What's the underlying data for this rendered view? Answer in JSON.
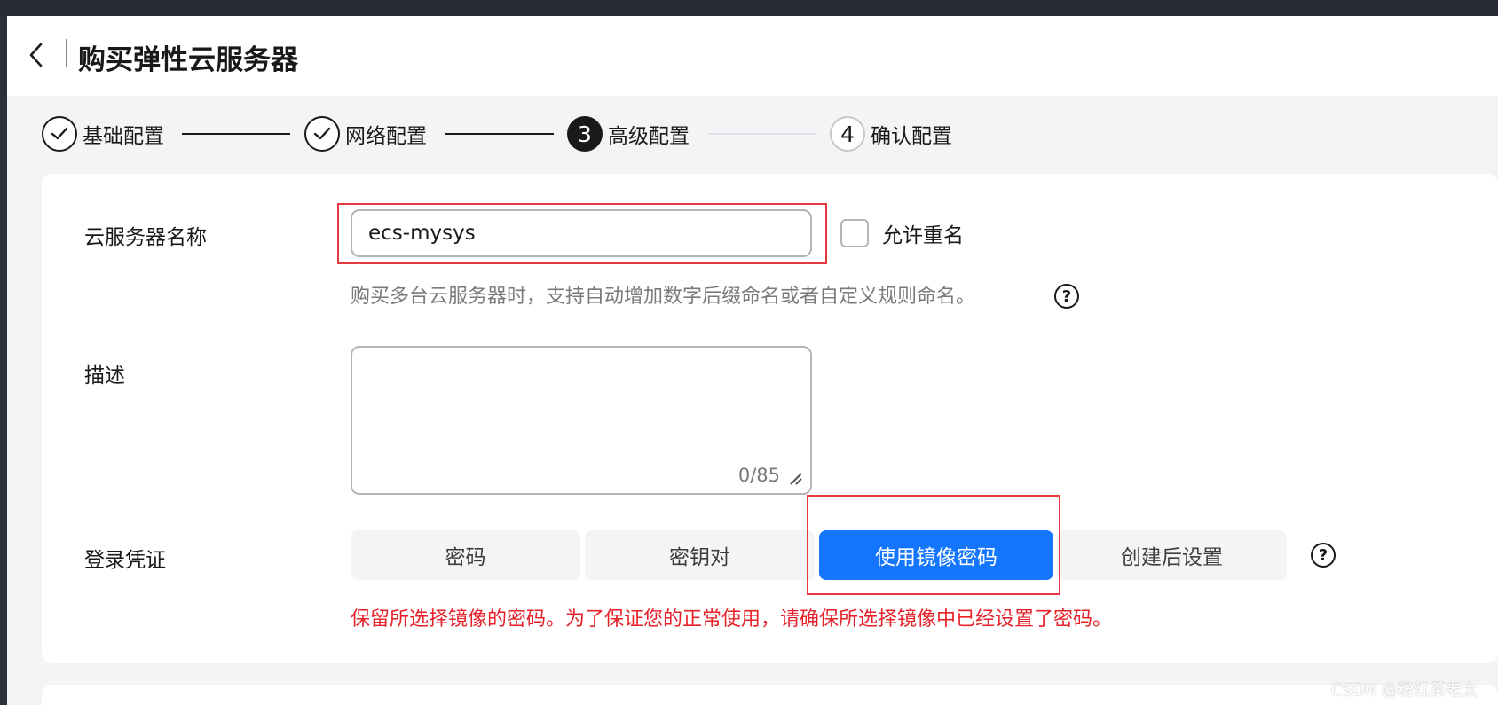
{
  "header": {
    "title": "购买弹性云服务器",
    "back_icon": "chevron-left-icon"
  },
  "steps": [
    {
      "label": "基础配置",
      "marker": "",
      "state": "done"
    },
    {
      "label": "网络配置",
      "marker": "",
      "state": "done"
    },
    {
      "label": "高级配置",
      "marker": "3",
      "state": "active"
    },
    {
      "label": "确认配置",
      "marker": "4",
      "state": "todo"
    }
  ],
  "form": {
    "name": {
      "label": "云服务器名称",
      "value": "ecs-mysys",
      "allow_duplicate_label": "允许重名",
      "allow_duplicate_checked": false,
      "hint": "购买多台云服务器时，支持自动增加数字后缀命名或者自定义规则命名。"
    },
    "description": {
      "label": "描述",
      "value": "",
      "counter": "0/85"
    },
    "login": {
      "label": "登录凭证",
      "options": [
        "密码",
        "密钥对",
        "使用镜像密码",
        "创建后设置"
      ],
      "selected": "使用镜像密码",
      "warning": "保留所选择镜像的密码。为了保证您的正常使用，请确保所选择镜像中已经设置了密码。"
    }
  },
  "watermark": "CSDN @粉红茶老太",
  "colors": {
    "accent": "#1476ff",
    "highlight": "#e6393f",
    "warning": "#e6212a",
    "text": "#191919",
    "muted": "#7a7a7a"
  }
}
